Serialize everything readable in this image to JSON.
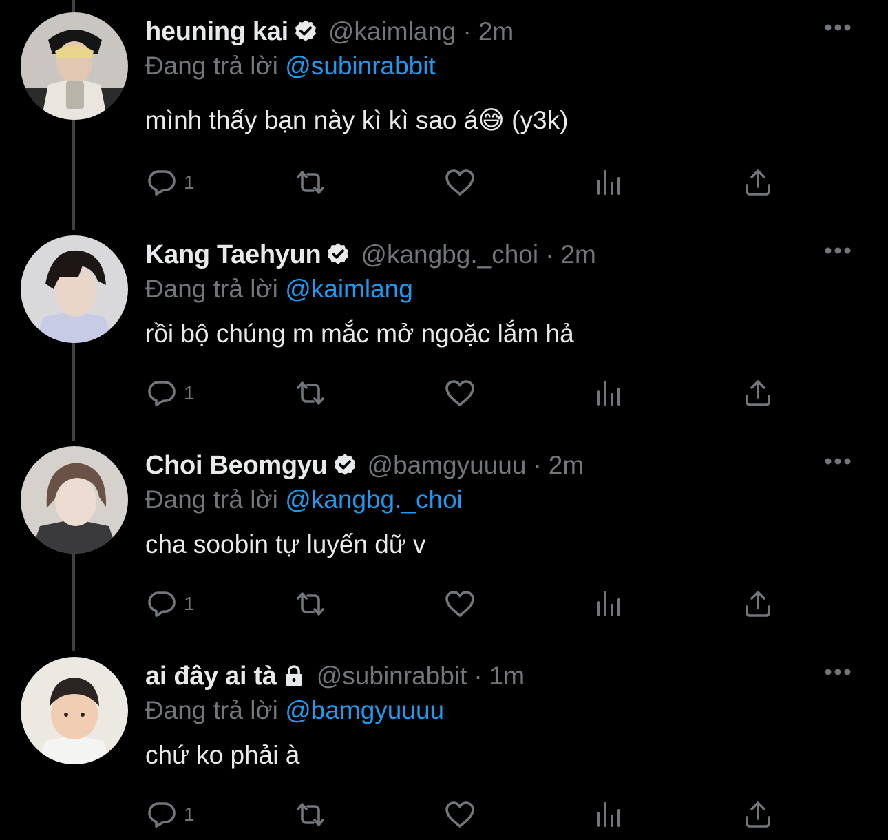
{
  "colors": {
    "background": "#000000",
    "text": "#e7e9ea",
    "secondary": "#71767b",
    "link": "#1d9bf0",
    "thread_line": "#3e4144"
  },
  "tweets": [
    {
      "display_name": "heuning kai",
      "badge": "verified-badge-icon",
      "handle": "@kaimlang",
      "separator": "·",
      "time": "2m",
      "reply_prefix": "Đang trả lời",
      "reply_to": "@subinrabbit",
      "text": "mình thấy bạn này kì kì sao á😅  (y3k)",
      "reply_count": "1"
    },
    {
      "display_name": "Kang Taehyun",
      "badge": "verified-badge-icon",
      "handle": "@kangbg._choi",
      "separator": "·",
      "time": "2m",
      "reply_prefix": "Đang trả lời",
      "reply_to": "@kaimlang",
      "text": "rồi bộ chúng m mắc mở ngoặc lắm hả",
      "reply_count": "1"
    },
    {
      "display_name": "Choi Beomgyu",
      "badge": "verified-badge-icon",
      "handle": "@bamgyuuuu",
      "separator": "·",
      "time": "2m",
      "reply_prefix": "Đang trả lời",
      "reply_to": "@kangbg._choi",
      "text": "cha soobin tự luyến dữ v",
      "reply_count": "1"
    },
    {
      "display_name": "ai đây ai tà",
      "badge": "lock-icon",
      "handle": "@subinrabbit",
      "separator": "·",
      "time": "1m",
      "reply_prefix": "Đang trả lời",
      "reply_to": "@bamgyuuuu",
      "text": "chứ ko phải à",
      "reply_count": "1"
    }
  ]
}
